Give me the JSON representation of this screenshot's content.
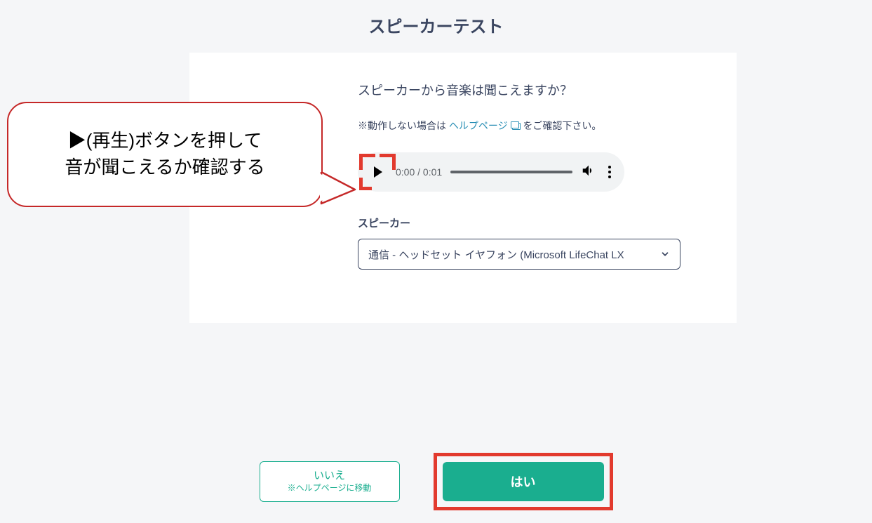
{
  "title": "スピーカーテスト",
  "question": "スピーカーから音楽は聞こえますか？",
  "help": {
    "prefix": "※動作しない場合は",
    "link_text": "ヘルプページ",
    "suffix": "をご確認下さい。"
  },
  "audio": {
    "current": "0:00",
    "total": "0:01"
  },
  "speaker_section_label": "スピーカー",
  "speaker_selected": "通信 - ヘッドセット イヤフォン (Microsoft LifeChat LX",
  "callout_line1": "▶(再生)ボタンを押して",
  "callout_line2": "音が聞こえるか確認する",
  "buttons": {
    "no_label": "いいえ",
    "no_sub": "※ヘルプページに移動",
    "yes_label": "はい"
  }
}
